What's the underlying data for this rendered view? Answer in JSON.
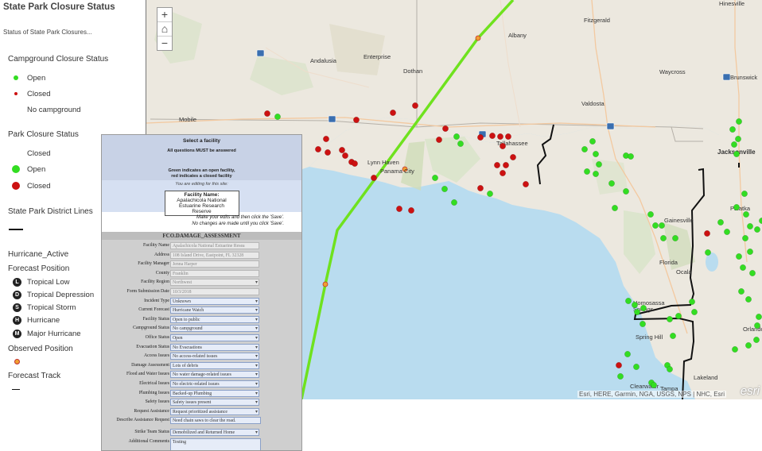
{
  "legend": {
    "title": "State Park Closure Status",
    "subtitle": "Status of State Park Closures...",
    "campground_heading": "Campground Closure Status",
    "campground_items": [
      "Open",
      "Closed",
      "No campground"
    ],
    "park_heading": "Park Closure Status",
    "park_items": [
      "Closed",
      "Open",
      "Closed"
    ],
    "district_heading": "State Park District Lines",
    "hurricane_heading": "Hurricane_Active",
    "forecast_position": "Forecast Position",
    "forecast_items": [
      {
        "glyph": "L",
        "label": "Tropical Low"
      },
      {
        "glyph": "D",
        "label": "Tropical Depression"
      },
      {
        "glyph": "S",
        "label": "Tropical Storm"
      },
      {
        "glyph": "H",
        "label": "Hurricane"
      },
      {
        "glyph": "M",
        "label": "Major Hurricane"
      }
    ],
    "observed_position": "Observed Position",
    "forecast_track": "Forecast Track",
    "colors": {
      "open": "#33dd22",
      "closed": "#cc1111",
      "observed": "#f0a030"
    }
  },
  "map": {
    "zoom_in": "+",
    "home": "⌂",
    "zoom_out": "−",
    "attribution": "Esri, HERE, Garmin, NGA, USGS, NPS | NHC, Esri",
    "esri_logo": "esri",
    "cities": [
      {
        "name": "Hinesville"
      },
      {
        "name": "Albany"
      },
      {
        "name": "Fitzgerald"
      },
      {
        "name": "Andalusia"
      },
      {
        "name": "Enterprise"
      },
      {
        "name": "Dothan"
      },
      {
        "name": "Waycross"
      },
      {
        "name": "Brunswick"
      },
      {
        "name": "Valdosta"
      },
      {
        "name": "Mobile"
      },
      {
        "name": "Tallahassee"
      },
      {
        "name": "Jacksonville"
      },
      {
        "name": "Lynn Haven"
      },
      {
        "name": "Panama City"
      },
      {
        "name": "Gainesville"
      },
      {
        "name": "Palatka"
      },
      {
        "name": "Florida"
      },
      {
        "name": "Ocala"
      },
      {
        "name": "Homosassa Springs"
      },
      {
        "name": "Spring Hill"
      },
      {
        "name": "Orlando"
      },
      {
        "name": "Clearwater"
      },
      {
        "name": "Tampa"
      },
      {
        "name": "Lakeland"
      }
    ]
  },
  "form": {
    "select_facility": "Select a facility",
    "must_answer": "All questions MUST be answered",
    "green_note": "Green indicates an open facility,\nred indicates a closed facility",
    "editing_note": "You are editing for this site:",
    "facility_name_label": "Facility Name:",
    "facility_name": "Apalachicola National Estuarine Research Reserve",
    "make_edits": "Make your edits and then click the 'Save'.",
    "no_changes": "No changes are made until you click 'Save'.",
    "table_title": "FCO.DAMAGE_ASSESSMENT",
    "fields": [
      {
        "label": "Facility Name",
        "value": "Apalachicola National Estuarine Resea",
        "kind": "ro"
      },
      {
        "label": "Address",
        "value": "108 Island Drive, Eastpoint, FL 32328",
        "kind": "ro"
      },
      {
        "label": "Facility Manager",
        "value": "Jenna Harper",
        "kind": "ro"
      },
      {
        "label": "County",
        "value": "Franklin",
        "kind": "ro"
      },
      {
        "label": "Facility Region",
        "value": "Northwest",
        "kind": "rosel"
      },
      {
        "label": "Form Submission Date",
        "value": "10/3/2018",
        "kind": "ro"
      },
      {
        "label": "Incident Type",
        "value": "Unknown",
        "kind": "sel"
      },
      {
        "label": "Current Forecast",
        "value": "Hurricane Watch",
        "kind": "sel"
      },
      {
        "label": "Facility Status",
        "value": "Open to public",
        "kind": "sel"
      },
      {
        "label": "Campground Status",
        "value": "No campground",
        "kind": "sel"
      },
      {
        "label": "Office Status",
        "value": "Open",
        "kind": "sel"
      },
      {
        "label": "Evacuation Status",
        "value": "No Evacuations",
        "kind": "sel"
      },
      {
        "label": "Access Issues",
        "value": "No access-related issues",
        "kind": "sel"
      },
      {
        "label": "Damage Assessment",
        "value": "Lots of debris",
        "kind": "sel"
      },
      {
        "label": "Flood and Water Issues",
        "value": "No water damage-related issues",
        "kind": "sel"
      },
      {
        "label": "Electrical Issues",
        "value": "No electric-related issues",
        "kind": "sel"
      },
      {
        "label": "Plumbing Issues",
        "value": "Backed-up Plumbing",
        "kind": "sel"
      },
      {
        "label": "Safety Issues",
        "value": "Safety issues present",
        "kind": "sel"
      },
      {
        "label": "Request Assistance",
        "value": "Request prioritized assistance",
        "kind": "sel"
      },
      {
        "label": "Describe Assistance Request",
        "value": "Need chain saws to clear the road.",
        "kind": "text2"
      },
      {
        "label": "Strike Team Status",
        "value": "Demobilized and Returned Home",
        "kind": "sel"
      },
      {
        "label": "Additional Comments",
        "value": "Testing",
        "kind": "tall"
      },
      {
        "label": "Best Contact Information",
        "value": "Test 555-123-4567",
        "kind": "text"
      }
    ]
  }
}
